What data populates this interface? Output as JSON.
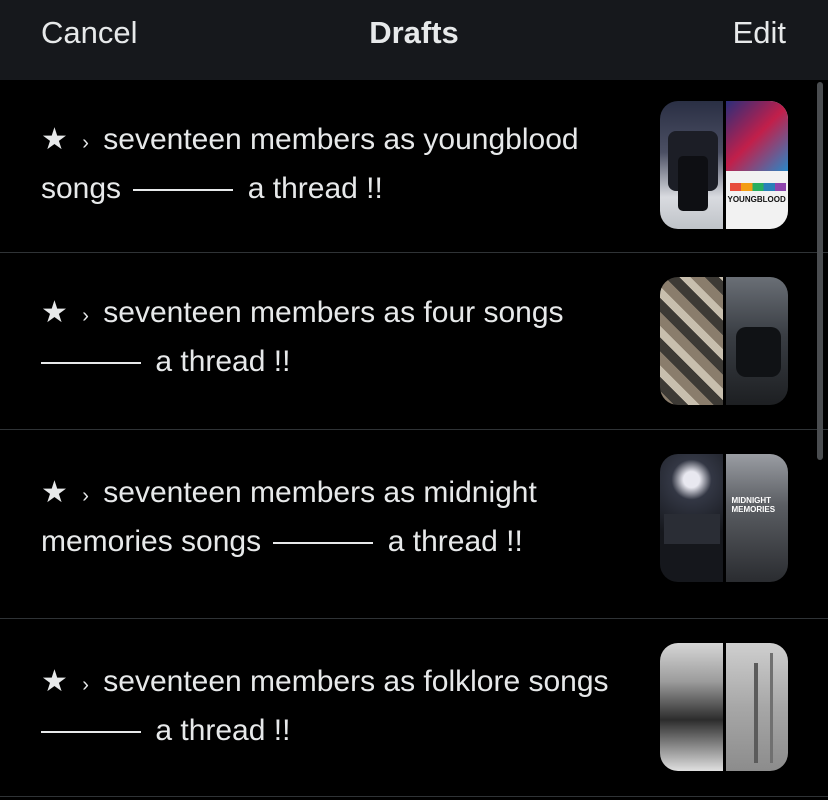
{
  "header": {
    "cancel_label": "Cancel",
    "title": "Drafts",
    "edit_label": "Edit"
  },
  "drafts": [
    {
      "star": "★",
      "sep": "›",
      "line1": "seventeen members as youngblood",
      "line2_pre": "songs",
      "line2_post": "a thread !!"
    },
    {
      "star": "★",
      "sep": "›",
      "line1": "seventeen members as four songs",
      "line2_pre": "",
      "line2_post": "a thread !!"
    },
    {
      "star": "★",
      "sep": "›",
      "line1": "seventeen members as midnight",
      "line2_pre": "memories songs",
      "line2_post": "a thread !!"
    },
    {
      "star": "★",
      "sep": "›",
      "line1": "seventeen members as folklore songs",
      "line2_pre": "",
      "line2_post": "a thread !!"
    }
  ],
  "thumb_labels": {
    "youngblood": "YOUNGBLOOD",
    "midnight": "MIDNIGHT MEMORIES"
  }
}
